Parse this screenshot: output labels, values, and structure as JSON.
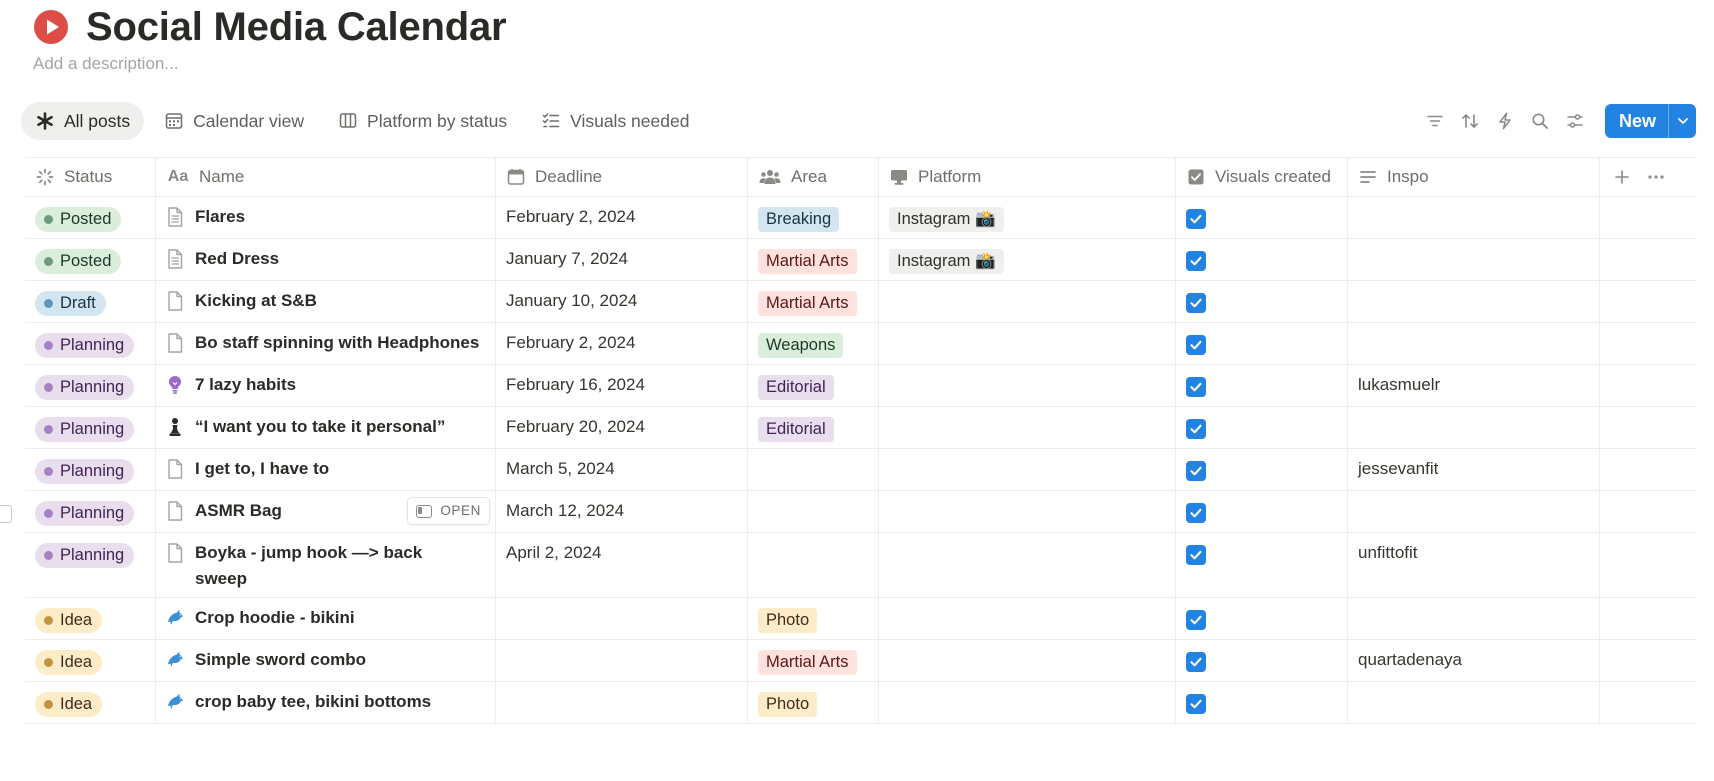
{
  "page": {
    "title": "Social Media Calendar",
    "description_placeholder": "Add a description..."
  },
  "views": [
    {
      "label": "All posts",
      "icon": "asterisk-icon",
      "active": true
    },
    {
      "label": "Calendar view",
      "icon": "calendar-icon",
      "active": false
    },
    {
      "label": "Platform by status",
      "icon": "board-icon",
      "active": false
    },
    {
      "label": "Visuals needed",
      "icon": "checklist-icon",
      "active": false
    }
  ],
  "toolbar": {
    "filter": "filter-icon",
    "sort": "sort-icon",
    "automation": "lightning-icon",
    "search": "search-icon",
    "settings": "sliders-icon",
    "new_label": "New"
  },
  "columns": {
    "status": "Status",
    "name": "Name",
    "deadline": "Deadline",
    "area": "Area",
    "platform": "Platform",
    "visuals": "Visuals created",
    "inspo": "Inspo"
  },
  "open_label": "OPEN",
  "colors": {
    "accent": "#2383e2",
    "posted": "#dbeddb",
    "draft": "#d3e5ef",
    "planning": "#e8deee",
    "idea": "#fdecc8"
  },
  "rows": [
    {
      "status": "Posted",
      "name": "Flares",
      "icon": "page-icon",
      "deadline": "February 2, 2024",
      "area": "Breaking",
      "platform": "Instagram 📸",
      "visuals": true,
      "inspo": ""
    },
    {
      "status": "Posted",
      "name": "Red Dress",
      "icon": "page-icon",
      "deadline": "January 7, 2024",
      "area": "Martial Arts",
      "platform": "Instagram 📸",
      "visuals": true,
      "inspo": ""
    },
    {
      "status": "Draft",
      "name": "Kicking at S&B",
      "icon": "page-blank-icon",
      "deadline": "January 10, 2024",
      "area": "Martial Arts",
      "platform": "",
      "visuals": true,
      "inspo": ""
    },
    {
      "status": "Planning",
      "name": "Bo staff spinning with Headphones",
      "icon": "page-blank-icon",
      "deadline": "February 2, 2024",
      "area": "Weapons",
      "platform": "",
      "visuals": true,
      "inspo": ""
    },
    {
      "status": "Planning",
      "name": "7 lazy habits",
      "icon": "lightbulb-icon",
      "deadline": "February 16, 2024",
      "area": "Editorial",
      "platform": "",
      "visuals": true,
      "inspo": "lukasmuelr"
    },
    {
      "status": "Planning",
      "name": "“I want you to take it personal”",
      "icon": "chess-pawn-icon",
      "deadline": "February 20, 2024",
      "area": "Editorial",
      "platform": "",
      "visuals": true,
      "inspo": ""
    },
    {
      "status": "Planning",
      "name": "I get to, I have to",
      "icon": "page-blank-icon",
      "deadline": "March 5, 2024",
      "area": "",
      "platform": "",
      "visuals": true,
      "inspo": "jessevanfit"
    },
    {
      "status": "Planning",
      "name": "ASMR Bag",
      "icon": "page-blank-icon",
      "deadline": "March 12, 2024",
      "area": "",
      "platform": "",
      "visuals": true,
      "inspo": "",
      "hover": true
    },
    {
      "status": "Planning",
      "name": "Boyka - jump hook —> back sweep",
      "icon": "page-blank-icon",
      "deadline": "April 2, 2024",
      "area": "",
      "platform": "",
      "visuals": true,
      "inspo": "unfittofit",
      "tall": true
    },
    {
      "status": "Idea",
      "name": "Crop hoodie - bikini",
      "icon": "dolphin-icon",
      "deadline": "",
      "area": "Photo",
      "platform": "",
      "visuals": true,
      "inspo": ""
    },
    {
      "status": "Idea",
      "name": "Simple sword combo",
      "icon": "dolphin-icon",
      "deadline": "",
      "area": "Martial Arts",
      "platform": "",
      "visuals": true,
      "inspo": "quartadenaya"
    },
    {
      "status": "Idea",
      "name": "crop baby tee, bikini bottoms",
      "icon": "dolphin-icon",
      "deadline": "",
      "area": "Photo",
      "platform": "",
      "visuals": true,
      "inspo": ""
    }
  ]
}
